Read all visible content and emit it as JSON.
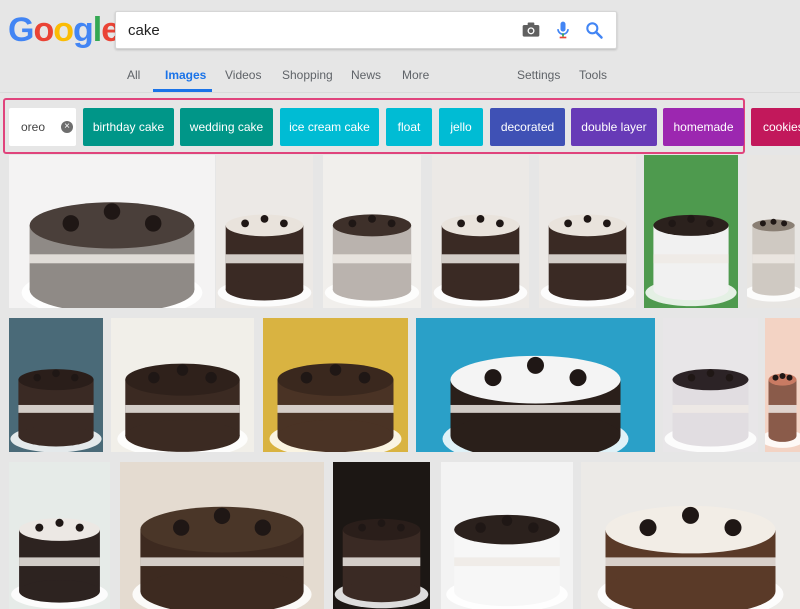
{
  "logo": {
    "letters": [
      {
        "char": "G",
        "color": "#4285f4"
      },
      {
        "char": "o",
        "color": "#ea4335"
      },
      {
        "char": "o",
        "color": "#fbbc05"
      },
      {
        "char": "g",
        "color": "#4285f4"
      },
      {
        "char": "l",
        "color": "#34a853"
      },
      {
        "char": "e",
        "color": "#ea4335"
      }
    ]
  },
  "search": {
    "value": "cake"
  },
  "nav": {
    "tabs": [
      "All",
      "Images",
      "Videos",
      "Shopping",
      "News",
      "More"
    ],
    "active": "Images",
    "settings_label": "Settings",
    "tools_label": "Tools"
  },
  "chips": [
    {
      "label": "oreo",
      "color": "#ffffff",
      "selected": true
    },
    {
      "label": "birthday cake",
      "color": "#009688"
    },
    {
      "label": "wedding cake",
      "color": "#009688"
    },
    {
      "label": "ice cream cake",
      "color": "#00bcd4"
    },
    {
      "label": "float",
      "color": "#00bcd4"
    },
    {
      "label": "jello",
      "color": "#00bcd4"
    },
    {
      "label": "decorated",
      "color": "#3f51b5"
    },
    {
      "label": "double layer",
      "color": "#673ab7"
    },
    {
      "label": "homemade",
      "color": "#9c27b0"
    },
    {
      "label": "cookies",
      "color": "#c2185b"
    }
  ],
  "image_rows": [
    [
      {
        "alt": "Oreo cake with slice cut out",
        "bg": "#f4f3f3",
        "cake": "#8f8a86",
        "top": "#4a3f3a"
      },
      {
        "alt": "Oreo layer cake slice",
        "bg": "#ece9e6",
        "cake": "#3a2a24",
        "top": "#e9e3dc"
      },
      {
        "alt": "Oreo cake with cookies on top",
        "bg": "#f1efec",
        "cake": "#bab3ae",
        "top": "#3e302a"
      },
      {
        "alt": "Oreo layer cake slice",
        "bg": "#ece9e6",
        "cake": "#3a2a24",
        "top": "#e9e3dc"
      },
      {
        "alt": "Oreo layer cake slice",
        "bg": "#ece9e6",
        "cake": "#3a2a24",
        "top": "#e9e3dc"
      },
      {
        "alt": "Oreo cake on stand",
        "bg": "#4e9a4e",
        "cake": "#f1f1f1",
        "top": "#2b211d"
      },
      {
        "alt": "Oreo cake partial",
        "bg": "#e8e6e3",
        "cake": "#cfc9c2",
        "top": "#8a7f74"
      }
    ],
    [
      {
        "alt": "Oreo cake roll",
        "bg": "#4a6a78",
        "cake": "#3a2a24",
        "top": "#2a1e1a"
      },
      {
        "alt": "Chocolate frosted oreo cake",
        "bg": "#f1efe9",
        "cake": "#3b2a22",
        "top": "#2f211b"
      },
      {
        "alt": "Oreo cookie cake",
        "bg": "#d9b341",
        "cake": "#4a3325",
        "top": "#3a281e"
      },
      {
        "alt": "Oreo drip cake",
        "bg": "#2aa0c8",
        "cake": "#2a1f1a",
        "top": "#f4f4f4"
      },
      {
        "alt": "Oreo cake with whipped cream",
        "bg": "#e8e6e8",
        "cake": "#e1dde1",
        "top": "#2c2326"
      },
      {
        "alt": "Cake partial",
        "bg": "#f3d3c4",
        "cake": "#8a5b4a",
        "top": "#c97b63"
      }
    ],
    [
      {
        "alt": "Oreo layer cake slice",
        "bg": "#e6ebe8",
        "cake": "#2d2320",
        "top": "#ece8e4"
      },
      {
        "alt": "Chocolate oreo cake slice",
        "bg": "#e4dbd0",
        "cake": "#3d2a20",
        "top": "#4a3628"
      },
      {
        "alt": "Oreo chocolate cake",
        "bg": "#1c1714",
        "cake": "#3a2a24",
        "top": "#2a1e1a"
      },
      {
        "alt": "Oreo drip cake on stand",
        "bg": "#f3f3f3",
        "cake": "#f7f7f7",
        "top": "#2b211d"
      },
      {
        "alt": "Mini oreo cake",
        "bg": "#eceae7",
        "cake": "#5a3a28",
        "top": "#f2ede6"
      }
    ]
  ]
}
